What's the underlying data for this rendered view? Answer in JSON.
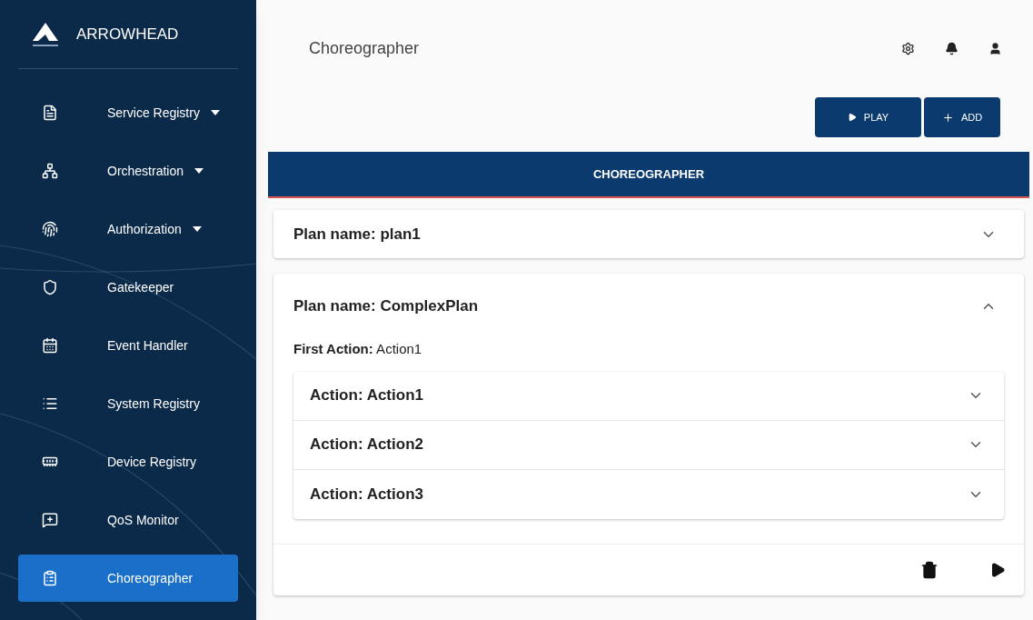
{
  "brand": {
    "name": "ARROWHEAD"
  },
  "sidebar": {
    "items": [
      {
        "label": "Service Registry",
        "has_menu": true,
        "selected": false
      },
      {
        "label": "Orchestration",
        "has_menu": true,
        "selected": false
      },
      {
        "label": "Authorization",
        "has_menu": true,
        "selected": false
      },
      {
        "label": "Gatekeeper",
        "has_menu": false,
        "selected": false
      },
      {
        "label": "Event Handler",
        "has_menu": false,
        "selected": false
      },
      {
        "label": "System Registry",
        "has_menu": false,
        "selected": false
      },
      {
        "label": "Device Registry",
        "has_menu": false,
        "selected": false
      },
      {
        "label": "QoS Monitor",
        "has_menu": false,
        "selected": false
      },
      {
        "label": "Choreographer",
        "has_menu": false,
        "selected": true
      }
    ]
  },
  "header": {
    "title": "Choreographer"
  },
  "actions": [
    {
      "kind": "play",
      "label": "PLAY"
    },
    {
      "kind": "add",
      "label": "ADD"
    }
  ],
  "tabs": [
    {
      "label": "CHOREOGRAPHER",
      "selected": true
    }
  ],
  "plans": [
    {
      "title": "Plan name: plan1",
      "expanded": false
    },
    {
      "title": "Plan name: ComplexPlan",
      "expanded": true,
      "first_action": "**First Action:** Action1",
      "actions": [
        {
          "title": "Action: Action1",
          "expanded": false
        },
        {
          "title": "Action: Action2",
          "expanded": false
        },
        {
          "title": "Action: Action3",
          "expanded": false
        }
      ]
    }
  ]
}
